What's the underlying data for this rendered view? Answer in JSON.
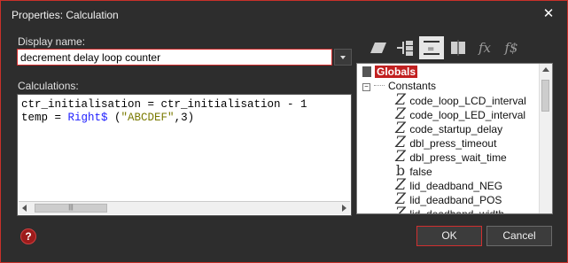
{
  "window": {
    "title": "Properties: Calculation"
  },
  "display_name": {
    "label": "Display name:",
    "value": "decrement delay loop counter"
  },
  "calculations": {
    "label": "Calculations:",
    "line1": "ctr_initialisation = ctr_initialisation - 1",
    "line2_prefix": "temp = ",
    "line2_func": "Right$",
    "line2_mid": " (",
    "line2_string": "\"ABCDEF\"",
    "line2_suffix": ",3)"
  },
  "toolbar": {
    "icons": [
      "parallelogram-icon",
      "branch-icon",
      "calc-box-icon",
      "column-icon",
      "fx-icon",
      "fs-icon"
    ],
    "fx": "fx",
    "fs": "f$"
  },
  "tree": {
    "root": "Globals",
    "constants": "Constants",
    "items": [
      {
        "icon": "Z",
        "label": "code_loop_LCD_interval"
      },
      {
        "icon": "Z",
        "label": "code_loop_LED_interval"
      },
      {
        "icon": "Z",
        "label": "code_startup_delay"
      },
      {
        "icon": "Z",
        "label": "dbl_press_timeout"
      },
      {
        "icon": "Z",
        "label": "dbl_press_wait_time"
      },
      {
        "icon": "b",
        "label": "false"
      },
      {
        "icon": "Z",
        "label": "lid_deadband_NEG"
      },
      {
        "icon": "Z",
        "label": "lid_deadband_POS"
      },
      {
        "icon": "Z",
        "label": "lid_deadband_width"
      }
    ]
  },
  "buttons": {
    "ok": "OK",
    "cancel": "Cancel",
    "help": "?"
  },
  "colors": {
    "accent": "#c8302a",
    "background": "#2d2d2d"
  }
}
